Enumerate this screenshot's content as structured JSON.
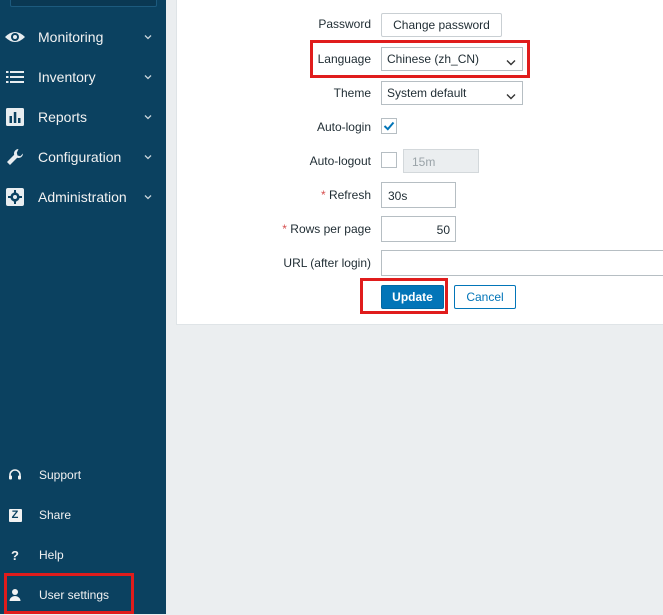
{
  "sidebar": {
    "menu": [
      {
        "label": "Monitoring",
        "icon": "eye-icon"
      },
      {
        "label": "Inventory",
        "icon": "list-icon"
      },
      {
        "label": "Reports",
        "icon": "bar-chart-icon"
      },
      {
        "label": "Configuration",
        "icon": "wrench-icon"
      },
      {
        "label": "Administration",
        "icon": "gear-icon"
      }
    ],
    "bottom": [
      {
        "label": "Support",
        "icon": "headset-icon",
        "glyph": ""
      },
      {
        "label": "Share",
        "icon": "share-icon",
        "glyph": "Z"
      },
      {
        "label": "Help",
        "icon": "help-icon",
        "glyph": "?"
      },
      {
        "label": "User settings",
        "icon": "user-icon",
        "glyph": ""
      }
    ]
  },
  "form": {
    "password": {
      "label": "Password",
      "button": "Change password"
    },
    "language": {
      "label": "Language",
      "value": "Chinese (zh_CN)"
    },
    "theme": {
      "label": "Theme",
      "value": "System default"
    },
    "autologin": {
      "label": "Auto-login",
      "checked": true
    },
    "autologout": {
      "label": "Auto-logout",
      "checked": false,
      "value": "15m"
    },
    "refresh": {
      "label": "Refresh",
      "value": "30s",
      "required": "*"
    },
    "rows": {
      "label": "Rows per page",
      "value": "50",
      "required": "*"
    },
    "url": {
      "label": "URL (after login)",
      "value": ""
    },
    "update_label": "Update",
    "cancel_label": "Cancel"
  },
  "colors": {
    "sidebar_bg": "#0b4160",
    "accent": "#0275b8",
    "highlight": "#e01c1c",
    "required": "#d64e4e"
  }
}
